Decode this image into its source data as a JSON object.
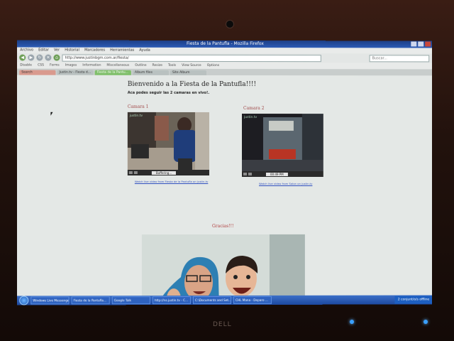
{
  "window": {
    "title": "Fiesta de la Pantufla - Mozilla Firefox"
  },
  "menu": [
    "Archivo",
    "Editar",
    "Ver",
    "Historial",
    "Marcadores",
    "Herramientas",
    "Ayuda"
  ],
  "navbar": {
    "url": "http://www.justinbgm.com.ar/fiesta/",
    "search_placeholder": "Buscar..."
  },
  "bookmarks": [
    "Disable",
    "CSS",
    "Forms",
    "Images",
    "Information",
    "Miscellaneous",
    "Outline",
    "Resize",
    "Tools",
    "View Source",
    "Options"
  ],
  "tabs": [
    {
      "label": "Search",
      "state": "red"
    },
    {
      "label": "Justin.tv - Fiesta d...",
      "state": "normal"
    },
    {
      "label": "Fiesta de la Pantu...",
      "state": "active"
    },
    {
      "label": "Album files",
      "state": "normal"
    },
    {
      "label": "Site Album",
      "state": "normal"
    }
  ],
  "page": {
    "heading": "Bienvenido a la Fiesta de la Pantufla!!!!",
    "subheading": "Aca podes seguir las 2 camaras en vivo!.",
    "camera1": {
      "label": "Camara 1",
      "watermark": "justin.tv",
      "status": "Buffering...",
      "link": "Watch live video from Fiesta de la Pantufla on justin.tv"
    },
    "camera2": {
      "label": "Camara 2",
      "watermark": "justin.tv",
      "status": "00:49 PM",
      "link": "Watch live video from Salon on justin.tv"
    },
    "thanks": "Gracias!!!"
  },
  "taskbar": {
    "tasks": [
      "Windows Live Messenger",
      "Fiesta de la Pantufla...",
      "Google Talk",
      "http://ns.justin.tv - C...",
      "C:\\Documents and Set...",
      "CHL Mana - Deparo ..."
    ],
    "tray_text": "2 conjunt/o/s offline"
  },
  "monitor": {
    "brand": "DELL"
  },
  "colors": {
    "titlebar": "#2c5bb5",
    "heading_red": "#a04848",
    "taskbar": "#1d49a0"
  }
}
